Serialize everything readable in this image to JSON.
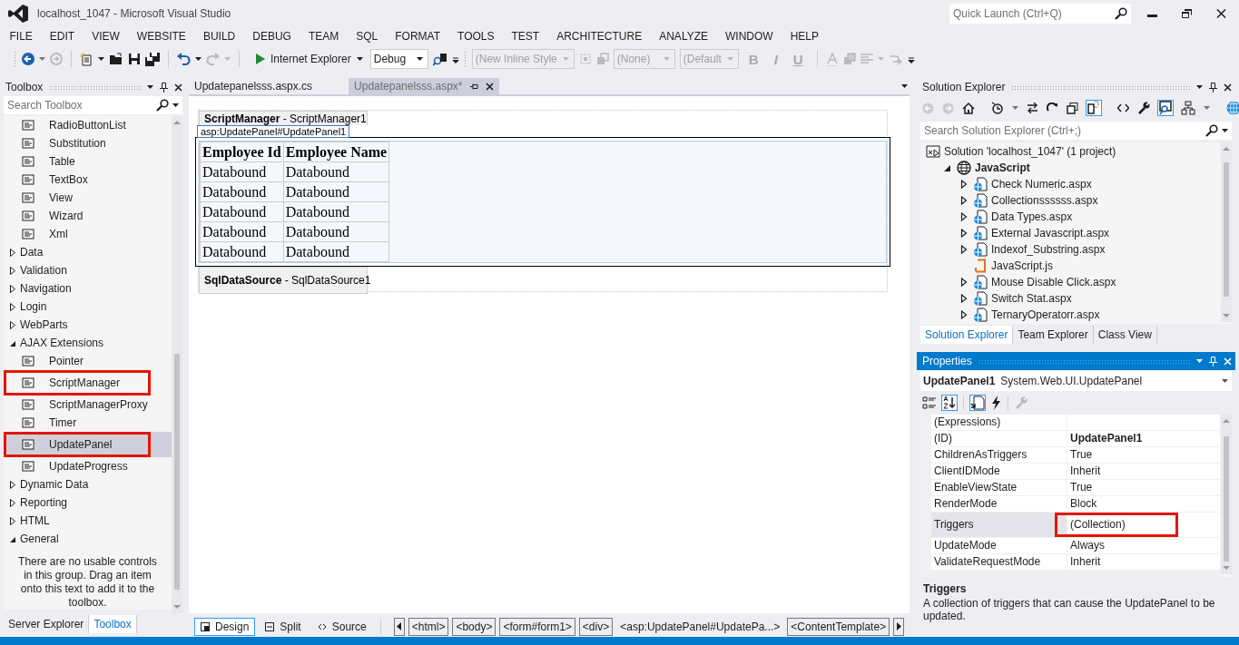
{
  "window": {
    "title": "localhost_1047 - Microsoft Visual Studio",
    "quick_launch": {
      "placeholder": "Quick Launch (Ctrl+Q)"
    }
  },
  "menu": [
    "FILE",
    "EDIT",
    "VIEW",
    "WEBSITE",
    "BUILD",
    "DEBUG",
    "TEAM",
    "SQL",
    "FORMAT",
    "TOOLS",
    "TEST",
    "ARCHITECTURE",
    "ANALYZE",
    "WINDOW",
    "HELP"
  ],
  "toolbar": {
    "run_target": "Internet Explorer",
    "configuration": "Debug",
    "style_boxes": [
      {
        "label": "(New Inline Style",
        "disabled": true
      },
      {
        "label": "(None)",
        "disabled": true
      },
      {
        "label": "(Default",
        "disabled": true
      }
    ],
    "format_buttons": [
      {
        "label": "B",
        "disabled": true
      },
      {
        "label": "I",
        "disabled": true
      },
      {
        "label": "U",
        "disabled": true
      }
    ]
  },
  "toolbox": {
    "title": "Toolbox",
    "search": {
      "placeholder": "Search Toolbox"
    },
    "items": [
      {
        "kind": "tool",
        "label": "RadioButtonList",
        "selected": false,
        "highlighted": false
      },
      {
        "kind": "tool",
        "label": "Substitution",
        "selected": false,
        "highlighted": false
      },
      {
        "kind": "tool",
        "label": "Table",
        "selected": false,
        "highlighted": false
      },
      {
        "kind": "tool",
        "label": "TextBox",
        "selected": false,
        "highlighted": false
      },
      {
        "kind": "tool",
        "label": "View",
        "selected": false,
        "highlighted": false
      },
      {
        "kind": "tool",
        "label": "Wizard",
        "selected": false,
        "highlighted": false
      },
      {
        "kind": "tool",
        "label": "Xml",
        "selected": false,
        "highlighted": false
      },
      {
        "kind": "group",
        "label": "Data",
        "expanded": false
      },
      {
        "kind": "group",
        "label": "Validation",
        "expanded": false
      },
      {
        "kind": "group",
        "label": "Navigation",
        "expanded": false
      },
      {
        "kind": "group",
        "label": "Login",
        "expanded": false
      },
      {
        "kind": "group",
        "label": "WebParts",
        "expanded": false
      },
      {
        "kind": "group",
        "label": "AJAX Extensions",
        "expanded": true,
        "children": [
          {
            "kind": "tool",
            "label": "Pointer",
            "selected": false,
            "highlighted": false
          },
          {
            "kind": "tool",
            "label": "ScriptManager",
            "selected": false,
            "highlighted": true
          },
          {
            "kind": "tool",
            "label": "ScriptManagerProxy",
            "selected": false,
            "highlighted": false
          },
          {
            "kind": "tool",
            "label": "Timer",
            "selected": false,
            "highlighted": false
          },
          {
            "kind": "tool",
            "label": "UpdatePanel",
            "selected": true,
            "highlighted": true
          },
          {
            "kind": "tool",
            "label": "UpdateProgress",
            "selected": false,
            "highlighted": false
          }
        ]
      },
      {
        "kind": "group",
        "label": "Dynamic Data",
        "expanded": false
      },
      {
        "kind": "group",
        "label": "Reporting",
        "expanded": false
      },
      {
        "kind": "group",
        "label": "HTML",
        "expanded": false
      },
      {
        "kind": "group",
        "label": "General",
        "expanded": true
      }
    ],
    "empty_message": "There are no usable controls in this group. Drag an item onto this text to add it to the toolbox.",
    "tabs": [
      {
        "label": "Server Explorer",
        "selected": false
      },
      {
        "label": "Toolbox",
        "selected": true
      }
    ]
  },
  "editor": {
    "tabs": [
      {
        "label": "Updatepanelsss.aspx.cs",
        "selected": false
      },
      {
        "label": "Updatepanelsss.aspx*",
        "selected": true
      }
    ],
    "script_manager": "**ScriptManager** - ScriptManager1",
    "panel_tag": "asp:UpdatePanel#UpdatePanel1",
    "grid": {
      "columns": [
        "Employee Id",
        "Employee Name"
      ],
      "rows": [
        [
          "Databound",
          "Databound"
        ],
        [
          "Databound",
          "Databound"
        ],
        [
          "Databound",
          "Databound"
        ],
        [
          "Databound",
          "Databound"
        ],
        [
          "Databound",
          "Databound"
        ]
      ]
    },
    "data_source": "**SqlDataSource** - SqlDataSource1",
    "views": [
      {
        "label": "Design",
        "selected": true
      },
      {
        "label": "Split",
        "selected": false
      },
      {
        "label": "Source",
        "selected": false
      }
    ],
    "breadcrumbs": [
      {
        "label": "<html>",
        "selected": false
      },
      {
        "label": "<body>",
        "selected": false
      },
      {
        "label": "<form#form1>",
        "selected": false
      },
      {
        "label": "<div>",
        "selected": false
      },
      {
        "label": "<asp:UpdatePanel#UpdatePa...>",
        "selected": true
      },
      {
        "label": "<ContentTemplate>",
        "selected": false
      }
    ]
  },
  "solution_explorer": {
    "title": "Solution Explorer",
    "search": {
      "placeholder": "Search Solution Explorer (Ctrl+;)"
    },
    "tree": [
      {
        "kind": "solution",
        "label": "Solution 'localhost_1047' (1 project)",
        "children": [
          {
            "kind": "project",
            "label": "JavaScript",
            "expanded": true,
            "children": [
              {
                "kind": "page",
                "label": "Check Numeric.aspx",
                "expanded": false
              },
              {
                "kind": "page",
                "label": "Collectionssssss.aspx",
                "expanded": false
              },
              {
                "kind": "page",
                "label": "Data Types.aspx",
                "expanded": false
              },
              {
                "kind": "page",
                "label": "External Javascript.aspx",
                "expanded": false
              },
              {
                "kind": "page",
                "label": "Indexof_Substring.aspx",
                "expanded": false
              },
              {
                "kind": "script",
                "label": "JavaScript.js"
              },
              {
                "kind": "page",
                "label": "Mouse Disable Click.aspx",
                "expanded": false
              },
              {
                "kind": "page",
                "label": "Switch Stat.aspx",
                "expanded": false
              },
              {
                "kind": "page",
                "label": "TernaryOperatorr.aspx",
                "expanded": false
              }
            ]
          }
        ]
      }
    ],
    "tabs": [
      {
        "label": "Solution Explorer",
        "selected": true
      },
      {
        "label": "Team Explorer",
        "selected": false
      },
      {
        "label": "Class View",
        "selected": false
      }
    ]
  },
  "properties": {
    "title": "Properties",
    "object": {
      "name": "UpdatePanel1",
      "type": "System.Web.UI.UpdatePanel"
    },
    "rows": [
      {
        "name": "(Expressions)",
        "selected": false
      },
      {
        "name": "(ID)",
        "value": "UpdatePanel1",
        "selected": false,
        "emphasized": true,
        "highlighted": false
      },
      {
        "name": "ChildrenAsTriggers",
        "value": "True",
        "selected": false,
        "emphasized": false,
        "highlighted": false
      },
      {
        "name": "ClientIDMode",
        "value": "Inherit",
        "selected": false,
        "emphasized": false,
        "highlighted": false
      },
      {
        "name": "EnableViewState",
        "value": "True",
        "selected": false,
        "emphasized": false,
        "highlighted": false
      },
      {
        "name": "RenderMode",
        "value": "Block",
        "selected": false,
        "emphasized": false,
        "highlighted": false
      },
      {
        "name": "Triggers",
        "value": "(Collection)",
        "selected": true,
        "emphasized": false,
        "highlighted": true
      },
      {
        "name": "UpdateMode",
        "value": "Always",
        "selected": false,
        "emphasized": false,
        "highlighted": false
      },
      {
        "name": "ValidateRequestMode",
        "value": "Inherit",
        "selected": false,
        "emphasized": false,
        "highlighted": false
      }
    ],
    "description": {
      "title": "Triggers",
      "text": "A collection of triggers that can cause the UpdatePanel to be updated."
    }
  }
}
